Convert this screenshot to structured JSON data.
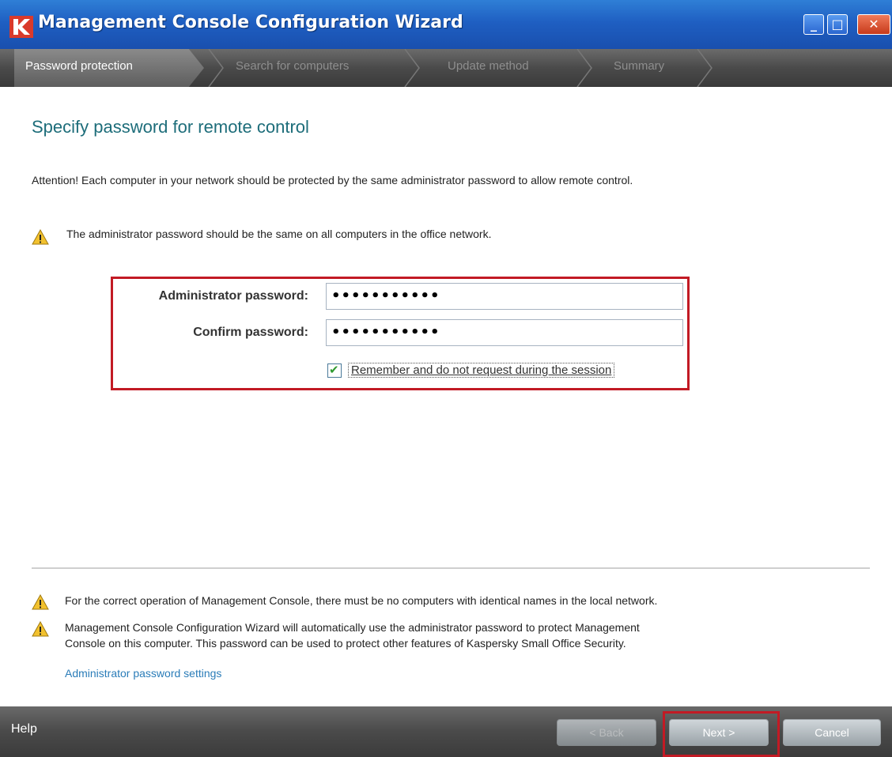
{
  "window": {
    "title": "Management Console Configuration Wizard",
    "controls": {
      "minimize": "minimize-icon",
      "maximize": "maximize-icon",
      "close": "close-icon"
    }
  },
  "steps": [
    {
      "label": "Password protection",
      "active": true
    },
    {
      "label": "Search for computers",
      "active": false
    },
    {
      "label": "Update method",
      "active": false
    },
    {
      "label": "Summary",
      "active": false
    }
  ],
  "content": {
    "heading": "Specify password for remote control",
    "attention": "Attention! Each computer in your network should be protected by the same administrator password to allow remote control.",
    "warning_top": "The administrator password should be the same on all computers in the office network.",
    "admin_password_label": "Administrator password:",
    "admin_password_value": "•••••••••••",
    "confirm_password_label": "Confirm password:",
    "confirm_password_value": "•••••••••••",
    "remember_label": "Remember and do not request during the session",
    "remember_checked": true,
    "warning_bottom_1": "For the correct operation of Management Console, there must be no computers with identical names in the local network.",
    "warning_bottom_2_line1": "Management Console Configuration Wizard will automatically use the administrator password to protect Management",
    "warning_bottom_2_line2": "Console on this computer. This password can be used to protect other features of Kaspersky Small Office Security.",
    "settings_link": "Administrator password settings"
  },
  "footer": {
    "help": "Help",
    "back": "< Back",
    "next": "Next >",
    "cancel": "Cancel"
  },
  "colors": {
    "titlebar": "#1f5fc2",
    "heading": "#1d6d7a",
    "highlight": "#c21a24",
    "link": "#2a7cb8"
  }
}
